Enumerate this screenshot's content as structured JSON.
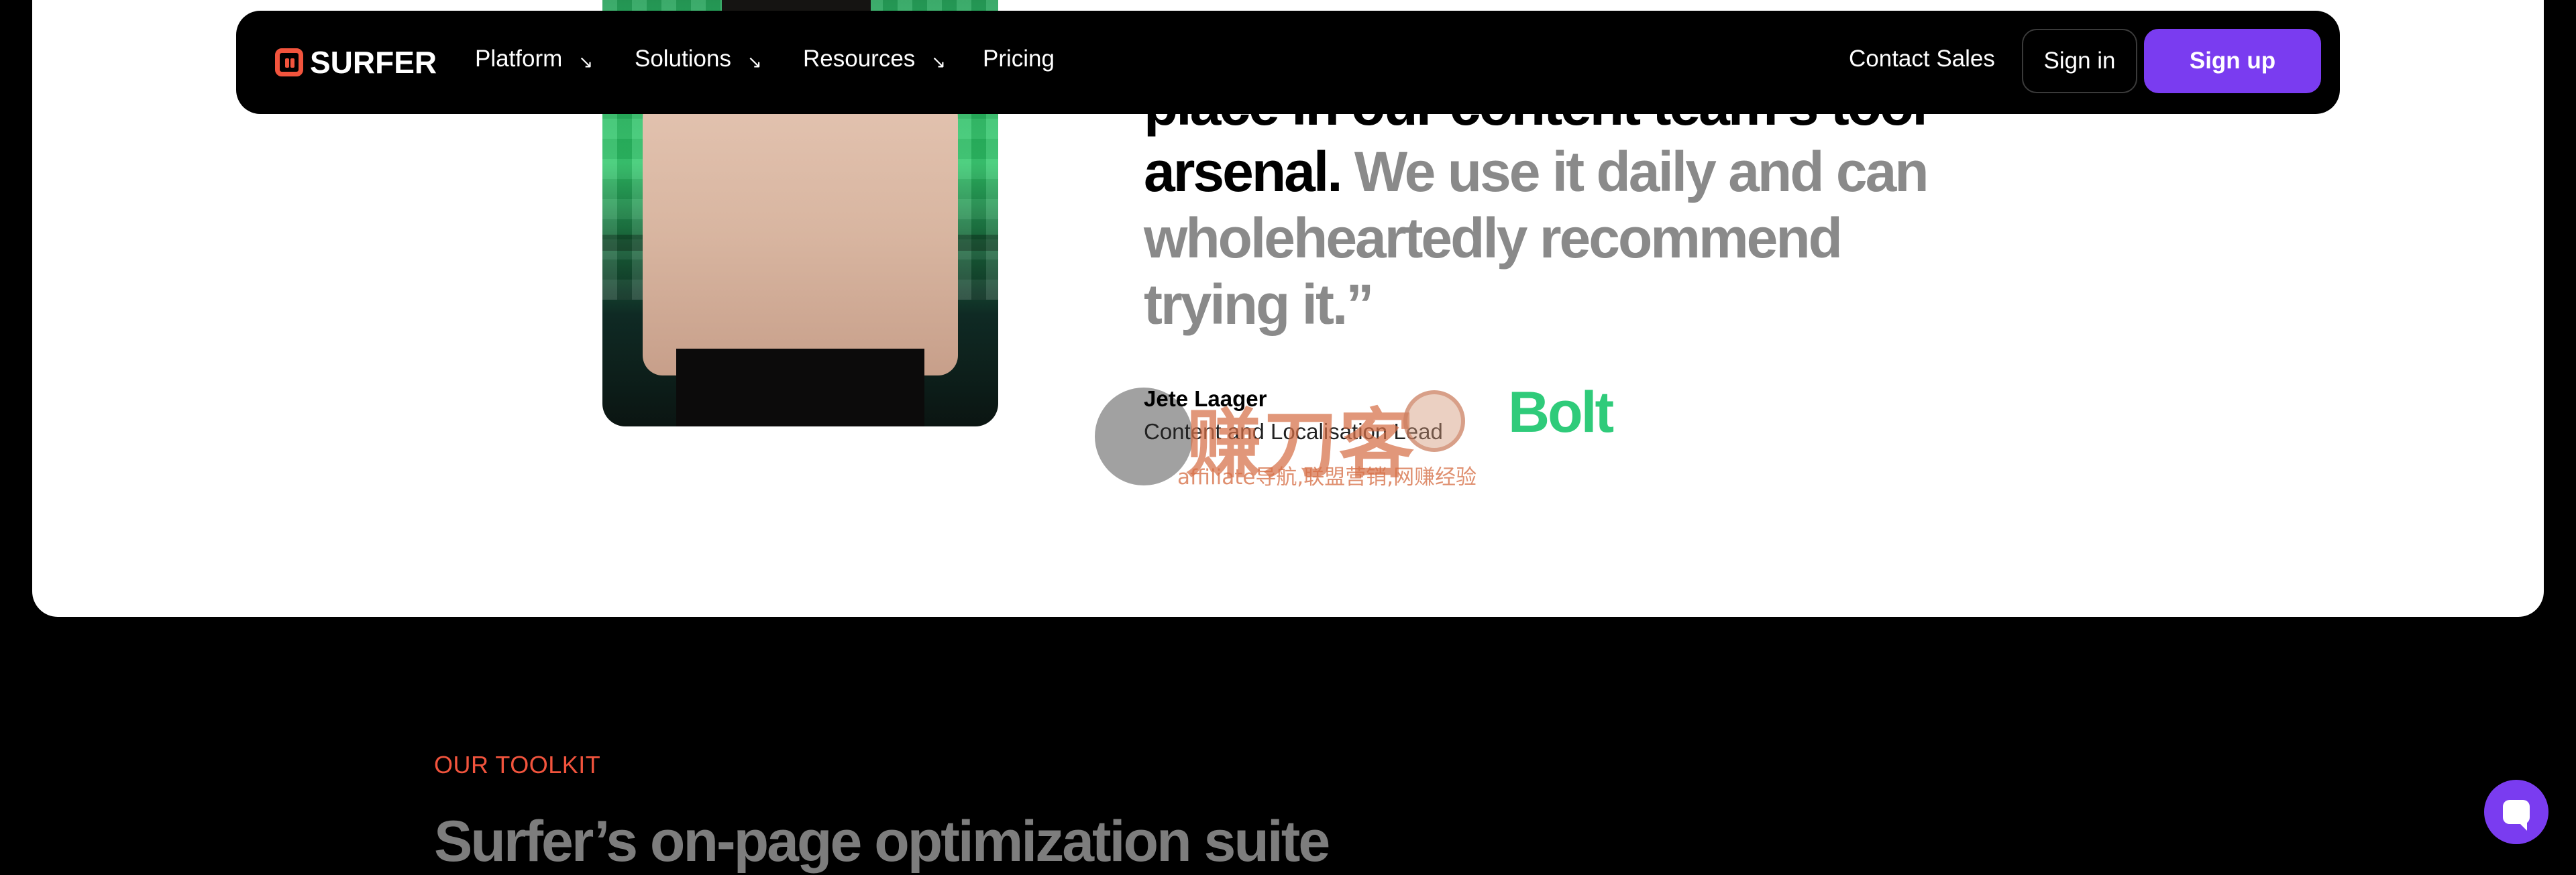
{
  "nav": {
    "logo_text": "SURFER",
    "items": [
      {
        "label": "Platform",
        "has_arrow": true
      },
      {
        "label": "Solutions",
        "has_arrow": true
      },
      {
        "label": "Resources",
        "has_arrow": true
      },
      {
        "label": "Pricing",
        "has_arrow": false
      }
    ],
    "arrow_glyph": "↘",
    "contact_sales": "Contact Sales",
    "sign_in": "Sign in",
    "sign_up": "Sign up"
  },
  "testimonial": {
    "quote_dark_line1": "place in our content team’s tool",
    "quote_dark_line2": "arsenal.",
    "quote_light": "We use it daily and can wholeheartedly recommend trying it.”",
    "author_name": "Jete Laager",
    "author_role": "Content and Localisation Lead",
    "company_logo_text": "Bolt"
  },
  "watermark": {
    "main": "赚刀客",
    "sub": "affiliate导航,联盟营销,网赚经验"
  },
  "toolkit": {
    "eyebrow": "OUR TOOLKIT",
    "title": "Surfer’s on-page optimization suite"
  },
  "colors": {
    "accent_purple": "#7a3cf0",
    "accent_orange": "#f2543d",
    "bolt_green": "#2fcb7a",
    "background": "#000000",
    "card": "#ffffff"
  },
  "icons": {
    "logo": "surfer-logo-icon",
    "chat": "chat-icon"
  }
}
